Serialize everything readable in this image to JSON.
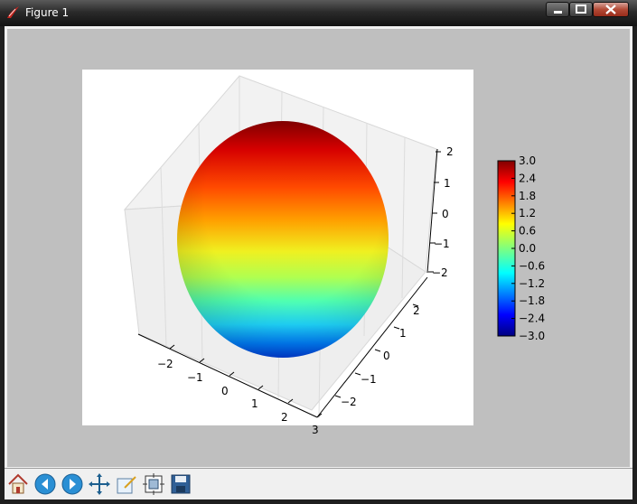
{
  "window": {
    "title": "Figure 1",
    "app_icon": "tk-feather-icon",
    "controls": [
      "minimize-icon",
      "maximize-icon",
      "close-icon"
    ]
  },
  "plot": {
    "type": "surface3d-sphere",
    "colormap": "jet",
    "x_ticks": [
      "−2",
      "−1",
      "0",
      "1",
      "2",
      "3"
    ],
    "y_ticks": [
      "−2",
      "−1",
      "0",
      "1",
      "2"
    ],
    "z_ticks": [
      "2",
      "1",
      "0",
      "−1",
      "−2"
    ]
  },
  "colorbar": {
    "ticks": [
      "3.0",
      "2.4",
      "1.8",
      "1.2",
      "0.6",
      "0.0",
      "−0.6",
      "−1.2",
      "−1.8",
      "−2.4",
      "−3.0"
    ],
    "range": [
      -3.0,
      3.0
    ]
  },
  "toolbar": {
    "buttons": [
      {
        "name": "home-button",
        "icon": "home-icon"
      },
      {
        "name": "back-button",
        "icon": "back-arrow-icon"
      },
      {
        "name": "forward-button",
        "icon": "forward-arrow-icon"
      },
      {
        "name": "pan-button",
        "icon": "pan-icon"
      },
      {
        "name": "zoom-button",
        "icon": "zoom-icon"
      },
      {
        "name": "subplots-button",
        "icon": "subplots-icon"
      },
      {
        "name": "save-button",
        "icon": "save-icon"
      }
    ]
  }
}
